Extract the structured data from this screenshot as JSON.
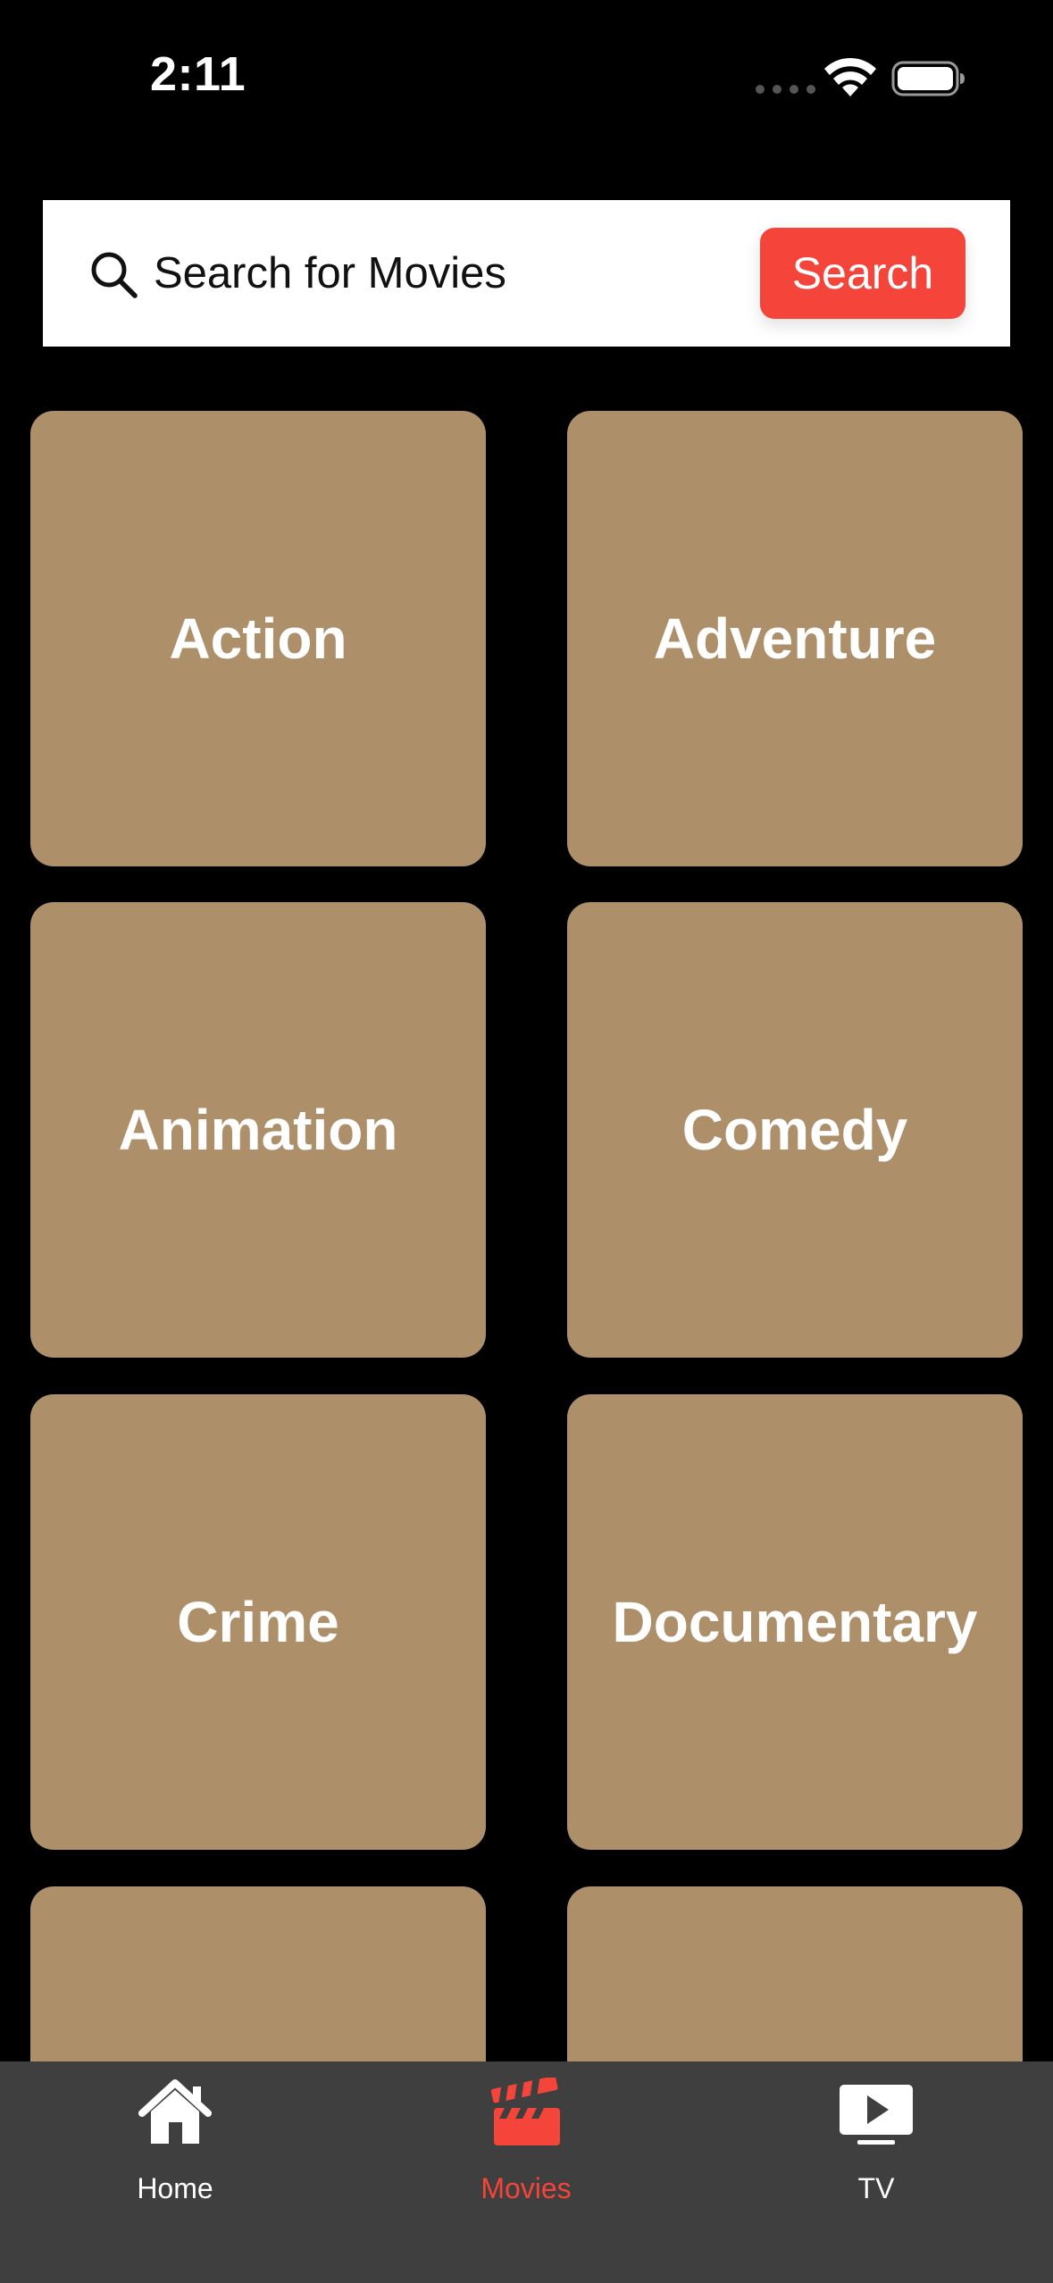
{
  "status_bar": {
    "time": "2:11"
  },
  "search": {
    "placeholder": "Search for Movies",
    "button_label": "Search"
  },
  "genres": [
    {
      "label": "Action"
    },
    {
      "label": "Adventure"
    },
    {
      "label": "Animation"
    },
    {
      "label": "Comedy"
    },
    {
      "label": "Crime"
    },
    {
      "label": "Documentary"
    },
    {
      "label": ""
    },
    {
      "label": ""
    }
  ],
  "tab_bar": {
    "items": [
      {
        "label": "Home",
        "icon": "house-icon",
        "active": false
      },
      {
        "label": "Movies",
        "icon": "clapperboard-icon",
        "active": true
      },
      {
        "label": "TV",
        "icon": "tv-play-icon",
        "active": false
      }
    ]
  },
  "colors": {
    "background": "#000000",
    "accent": "#f5443a",
    "genre_card": "#ad8f6a",
    "tab_bar": "#3f3f3f"
  }
}
